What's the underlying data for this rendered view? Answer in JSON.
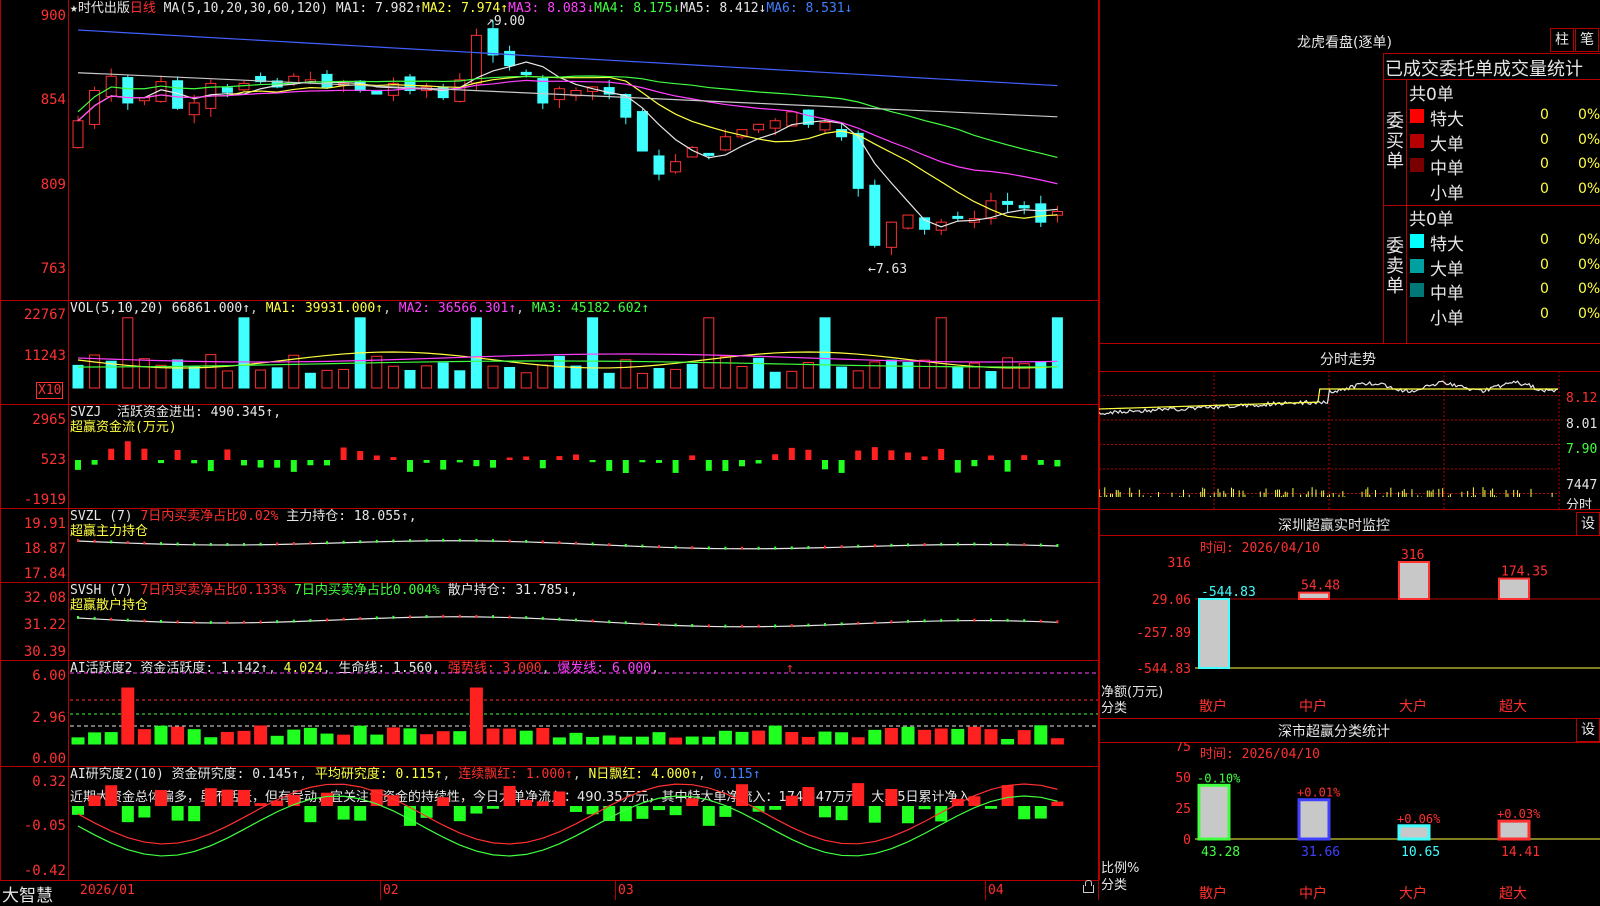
{
  "main_chart": {
    "price_axis": [
      "900",
      "854",
      "809",
      "763"
    ],
    "legend": {
      "star_name": "★时代出版",
      "period": "日线",
      "ma_label": "MA(5,10,20,30,60,120)",
      "ma1": "MA1: 7.982↑",
      "ma2": "MA2: 7.974↑",
      "ma3": "MA3: 8.083↓",
      "ma4": "MA4: 8.175↓",
      "ma5": "MA5: 8.412↓",
      "ma6": "MA6: 8.531↓"
    },
    "high_marker": "9.00",
    "low_marker": "7.63"
  },
  "volume_panel": {
    "axis": [
      "22767",
      "11243",
      "X10"
    ],
    "legend": {
      "name": "VOL(5,10,20)",
      "vol": "66861.000↑",
      "ma1": "MA1: 39931.000↑",
      "ma2": "MA2: 36566.301↑",
      "ma3": "MA3: 45182.602↑"
    }
  },
  "svzj_panel": {
    "axis": [
      "2965",
      "523",
      "-1919"
    ],
    "legend": {
      "name": "SVZJ",
      "text": "活跃资金进出: 490.345↑,",
      "sub": "超赢资金流(万元)"
    }
  },
  "svzl_panel": {
    "axis": [
      "19.91",
      "18.87",
      "17.84"
    ],
    "legend": {
      "name": "SVZL (7)",
      "ratio": "7日内买卖净占比0.02%",
      "hold": "主力持仓: 18.055↑,",
      "sub": "超赢主力持仓"
    }
  },
  "svsh_panel": {
    "axis": [
      "32.08",
      "31.22",
      "30.39"
    ],
    "legend": {
      "name": "SVSH (7)",
      "ratio1": "7日内买卖净占比0.133%",
      "ratio2": "7日内买卖净占比0.004%",
      "hold": "散户持仓: 31.785↓,",
      "sub": "超赢散户持仓"
    }
  },
  "ai_active_panel": {
    "axis": [
      "6.00",
      "2.96",
      "0.00"
    ],
    "legend": {
      "name": "AI活跃度2",
      "active": "资金活跃度: 1.142↑",
      "val2": "4.024",
      "life": "生命线: 1.560",
      "strong": "强势线: 3.000",
      "burst": "爆发线: 6.000",
      "arrow": "↑"
    }
  },
  "ai_research_panel": {
    "axis": [
      "0.32",
      "-0.05",
      "-0.42"
    ],
    "legend": {
      "name": "AI研究度2(10)",
      "research": "资金研究度: 0.145↑",
      "avg": "平均研究度: 0.115↑",
      "streak": "连续飘红: 1.000↑",
      "nday": "N日飘红: 4.000↑",
      "val": "0.115↑"
    },
    "commentary": "近期大资金总体偏多，虽不活跃，但有异动，宜关注大资金的持续性，今日大单净流入：490.35万元，其中特大单净流入：174.347万元，大单5日累计净入"
  },
  "bottom_axis": {
    "brand": "大智慧",
    "dates": [
      "2026/01",
      "02",
      "03",
      "04"
    ]
  },
  "right_panel": {
    "dragon_title": "龙虎看盘(逐单)",
    "btn_bar": "柱",
    "btn_pen": "笔",
    "stats_title": "已成交委托单成交量统计",
    "buy": {
      "side_label": "委买单",
      "count": "共0单",
      "rows": [
        {
          "name": "特大",
          "v1": "0",
          "v2": "0%",
          "color": "#ff0000"
        },
        {
          "name": "大单",
          "v1": "0",
          "v2": "0%",
          "color": "#b40000"
        },
        {
          "name": "中单",
          "v1": "0",
          "v2": "0%",
          "color": "#780000"
        },
        {
          "name": "小单",
          "v1": "0",
          "v2": "0%",
          "color": "#000000"
        }
      ]
    },
    "sell": {
      "side_label": "委卖单",
      "count": "共0单",
      "rows": [
        {
          "name": "特大",
          "v1": "0",
          "v2": "0%",
          "color": "#00ffff"
        },
        {
          "name": "大单",
          "v1": "0",
          "v2": "0%",
          "color": "#00a0a0"
        },
        {
          "name": "中单",
          "v1": "0",
          "v2": "0%",
          "color": "#007878"
        },
        {
          "name": "小单",
          "v1": "0",
          "v2": "0%",
          "color": "#000000"
        }
      ]
    },
    "intraday": {
      "title": "分时走势",
      "price_labels": [
        "8.12",
        "8.01",
        "7.90"
      ],
      "vol_label": "7447",
      "vol_unit": "分时"
    },
    "sz_monitor": {
      "title": "深圳超赢实时监控",
      "btn": "设",
      "time": "时间: 2026/04/10",
      "axis": [
        "316",
        "29.06",
        "-257.89",
        "-544.83"
      ],
      "unit": "净额(万元)",
      "cat_label": "分类",
      "categories": [
        "散户",
        "中户",
        "大户",
        "超大"
      ],
      "values": [
        "-544.83",
        "54.48",
        "316",
        "174.35"
      ]
    },
    "sz_class": {
      "title": "深市超赢分类统计",
      "btn": "设",
      "time": "时间: 2026/04/10",
      "axis": [
        "75",
        "50",
        "25",
        "0"
      ],
      "unit": "比例%",
      "cat_label": "分类",
      "categories": [
        "散户",
        "中户",
        "大户",
        "超大"
      ],
      "bottom_values": [
        "43.28",
        "31.66",
        "10.65",
        "14.41"
      ],
      "top_labels": [
        "-0.10%",
        "+0.01%",
        "+0.06%",
        "+0.03%"
      ]
    }
  }
}
